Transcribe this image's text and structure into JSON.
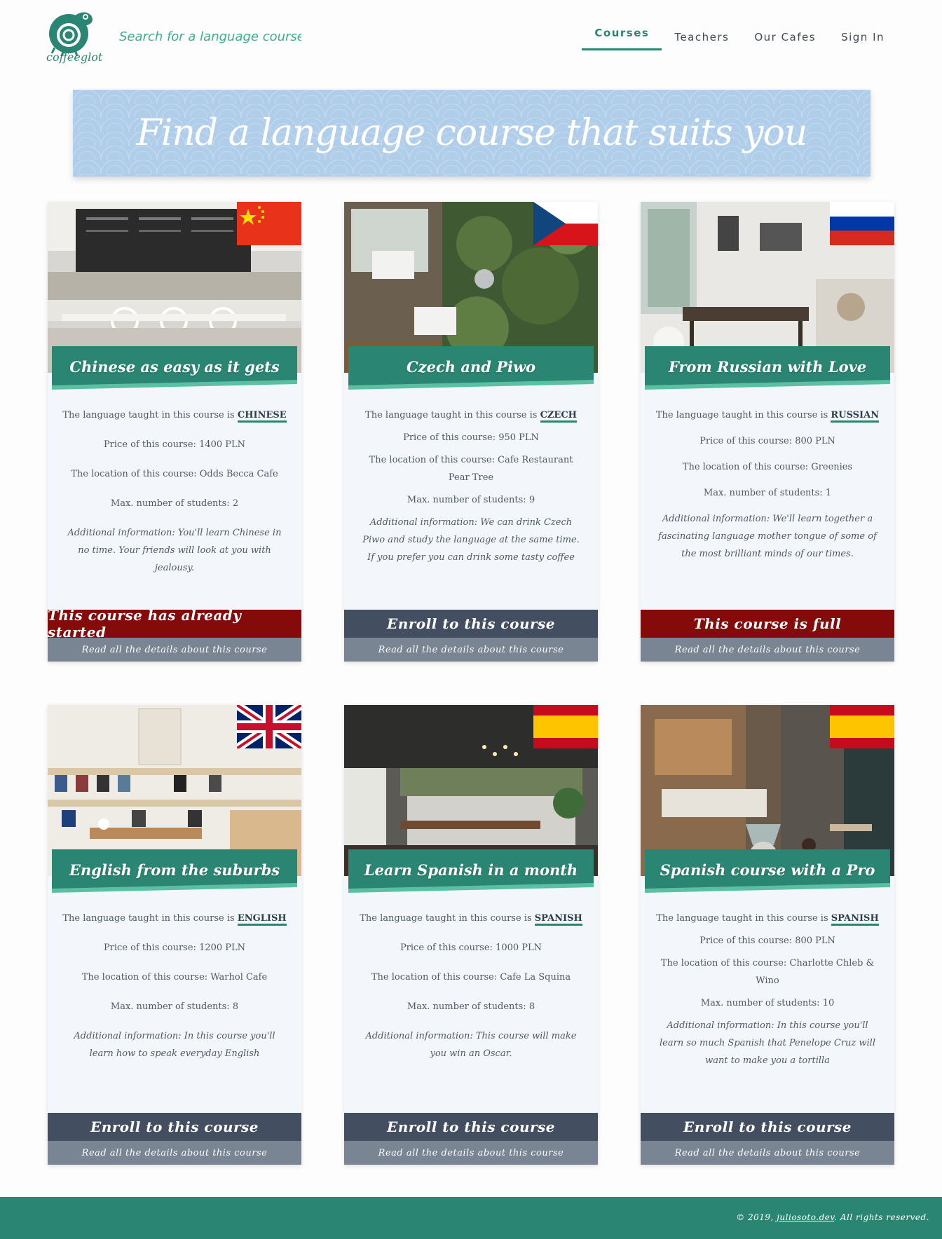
{
  "header": {
    "logo_text": "coffeeglot",
    "search_placeholder": "Search for a language course",
    "nav": [
      {
        "label": "Courses",
        "active": true
      },
      {
        "label": "Teachers",
        "active": false
      },
      {
        "label": "Our Cafes",
        "active": false
      },
      {
        "label": "Sign In",
        "active": false
      }
    ]
  },
  "banner": {
    "title": "Find a language course that suits you"
  },
  "labels": {
    "language_prefix": "The language taught in this course is",
    "details_link": "Read all the details about this course"
  },
  "courses": [
    {
      "title": "Chinese as easy as it gets",
      "flag": "china-flag",
      "language": "CHINESE",
      "price": "Price of this course: 1400 PLN",
      "location": "The location of this course: Odds Becca Cafe",
      "max_students": "Max. number of students: 2",
      "info": "Additional information: You'll learn Chinese in no time. Your friends will look at you with jealousy.",
      "status": "started",
      "cta": "This course has already started"
    },
    {
      "title": "Czech and Piwo",
      "flag": "czech-flag",
      "language": "CZECH",
      "price": "Price of this course: 950 PLN",
      "location": "The location of this course: Cafe Restaurant Pear Tree",
      "max_students": "Max. number of students: 9",
      "info": "Additional information: We can drink Czech Piwo and study the language at the same time. If you prefer you can drink some tasty coffee",
      "status": "enroll",
      "cta": "Enroll to this course"
    },
    {
      "title": "From Russian with Love",
      "flag": "russia-flag",
      "language": "RUSSIAN",
      "price": "Price of this course: 800 PLN",
      "location": "The location of this course: Greenies",
      "max_students": "Max. number of students: 1",
      "info": "Additional information: We'll learn together a fascinating language mother tongue of some of the most brilliant minds of our times.",
      "status": "full",
      "cta": "This course is full"
    },
    {
      "title": "English from the suburbs",
      "flag": "uk-flag",
      "language": "ENGLISH",
      "price": "Price of this course: 1200 PLN",
      "location": "The location of this course: Warhol Cafe",
      "max_students": "Max. number of students: 8",
      "info": "Additional information: In this course you'll learn how to speak everyday English",
      "status": "enroll",
      "cta": "Enroll to this course"
    },
    {
      "title": "Learn Spanish in a month",
      "flag": "spain-flag",
      "language": "SPANISH",
      "price": "Price of this course: 1000 PLN",
      "location": "The location of this course: Cafe La Squina",
      "max_students": "Max. number of students: 8",
      "info": "Additional information: This course will make you win an Oscar.",
      "status": "enroll",
      "cta": "Enroll to this course"
    },
    {
      "title": "Spanish course with a Pro",
      "flag": "spain-flag",
      "language": "SPANISH",
      "price": "Price of this course: 800 PLN",
      "location": "The location of this course: Charlotte Chleb & Wino",
      "max_students": "Max. number of students: 10",
      "info": "Additional information: In this course you'll learn so much Spanish that Penelope Cruz will want to make you a tortilla",
      "status": "enroll",
      "cta": "Enroll to this course"
    }
  ],
  "footer": {
    "prefix": "© 2019,",
    "link": "juliosoto.dev",
    "suffix": ". All rights reserved."
  },
  "colors": {
    "brand": "#2a8672",
    "accent": "#3cae8d",
    "enroll": "#434f60",
    "closed": "#850b0b",
    "banner": "#b0cdea"
  }
}
